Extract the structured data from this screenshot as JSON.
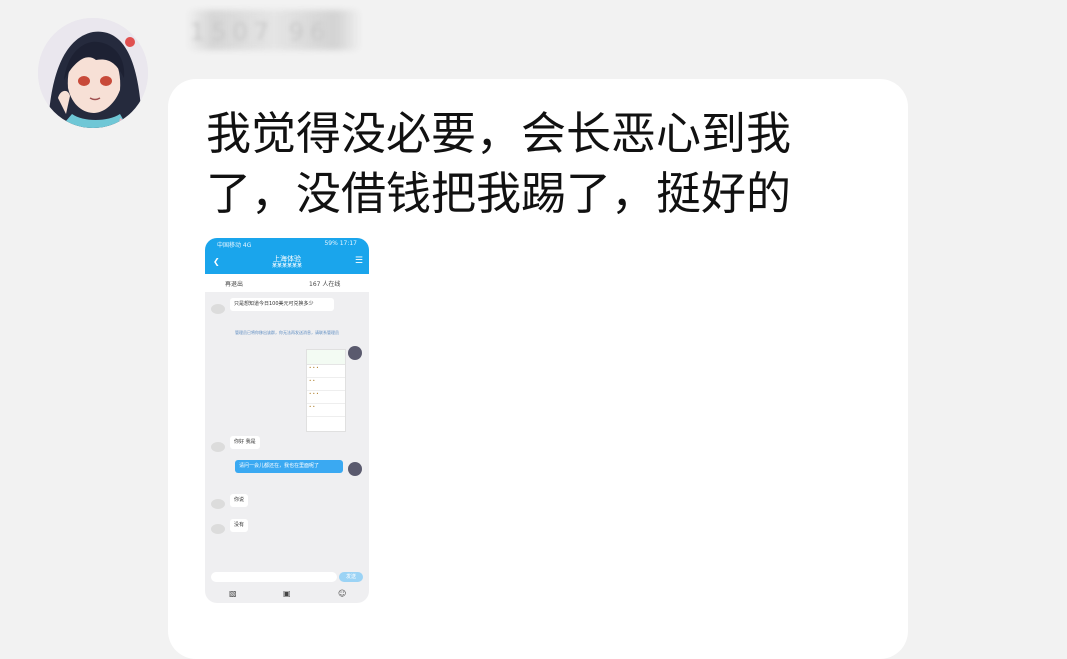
{
  "chat": {
    "sender_name": "1507  96",
    "message_text": "我觉得没必要，会长恶心到我了，没借钱把我踢了，挺好的"
  },
  "embedded_screenshot": {
    "status_left": "中国移动 4G",
    "status_right": "59% 17:17",
    "title": "上海体验",
    "subtitle": "某某某某某某",
    "info_left": "再退出",
    "info_right": "167 人在线",
    "bubble1": "只是想知道今日100美元可兑换多少",
    "system_note": "管理员已将你移出该群，你无法再发送消息，请联系管理员",
    "bubble2": "你好 我是",
    "bubble3": "请问一会儿都还在，我也在里面呢了",
    "bubble4": "你说",
    "bubble5": "没有",
    "send_label": "发送"
  }
}
